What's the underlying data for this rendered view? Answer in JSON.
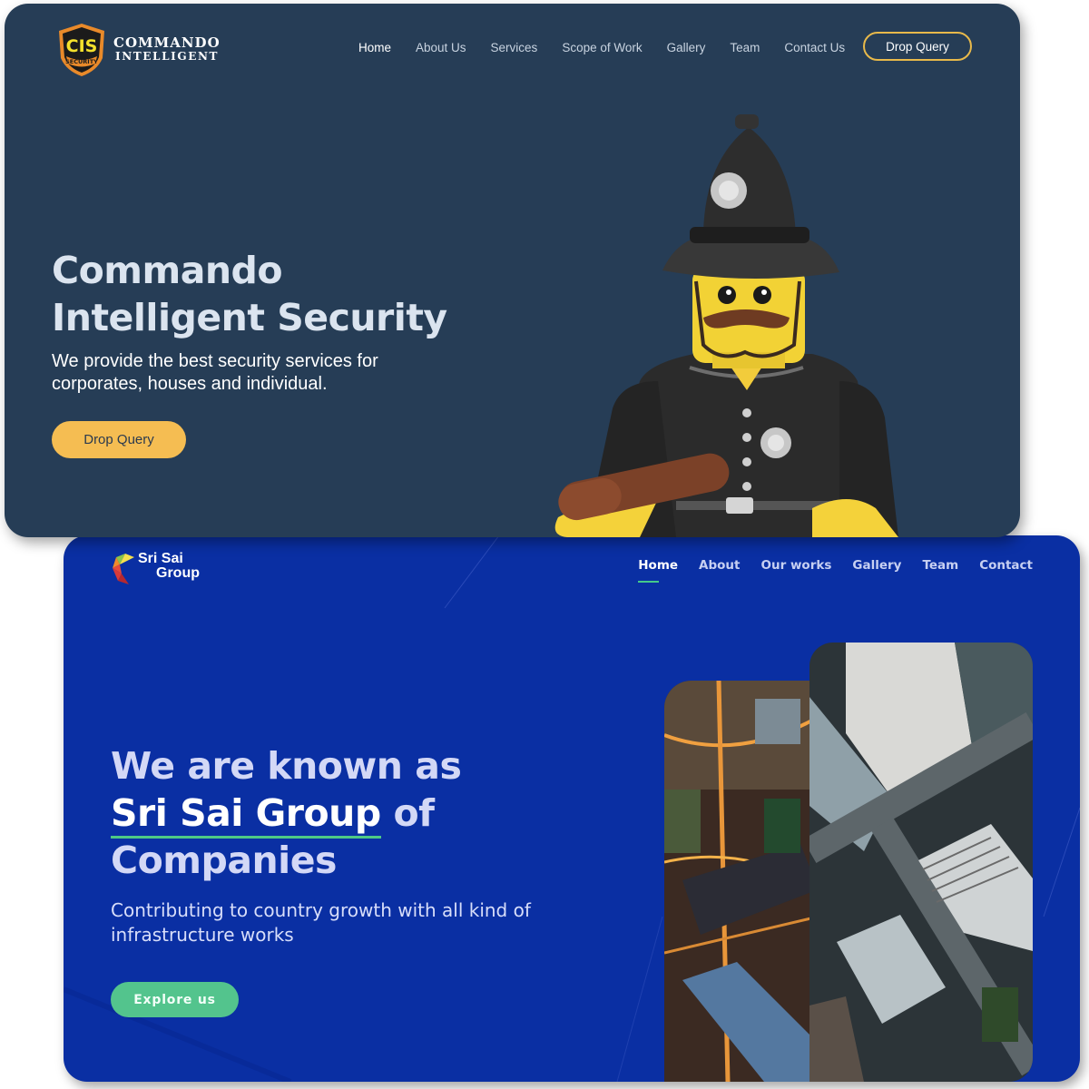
{
  "commando": {
    "logo": {
      "badge_text": "CIS",
      "badge_subtext": "SECURITY",
      "line1": "COMMANDO",
      "line2": "INTELLIGENT"
    },
    "nav": [
      {
        "label": "Home",
        "active": true
      },
      {
        "label": "About Us",
        "active": false
      },
      {
        "label": "Services",
        "active": false
      },
      {
        "label": "Scope of Work",
        "active": false
      },
      {
        "label": "Gallery",
        "active": false
      },
      {
        "label": "Team",
        "active": false
      },
      {
        "label": "Contact Us",
        "active": false
      }
    ],
    "nav_button": "Drop Query",
    "hero": {
      "title_line1": "Commando",
      "title_line2": "Intelligent Security",
      "subtitle_line1": "We provide the best security services for",
      "subtitle_line2": "corporates, houses and individual.",
      "cta": "Drop Query"
    },
    "hero_image": "lego-police-officer-figure",
    "colors": {
      "background": "#263d56",
      "accent": "#f5bd52",
      "outline": "#e8b94a"
    }
  },
  "srisai": {
    "logo": {
      "line1": "Sri Sai",
      "line2": "Group"
    },
    "nav": [
      {
        "label": "Home",
        "active": true
      },
      {
        "label": "About",
        "active": false
      },
      {
        "label": "Our works",
        "active": false
      },
      {
        "label": "Gallery",
        "active": false
      },
      {
        "label": "Team",
        "active": false
      },
      {
        "label": "Contact",
        "active": false
      }
    ],
    "hero": {
      "title_line1": "We are known as",
      "title_highlight": "Sri Sai Group",
      "title_line2_rest": " of",
      "title_line3": "Companies",
      "subtitle_line1": "Contributing to country growth with all kind of",
      "subtitle_line2": "infrastructure works",
      "cta": "Explore us"
    },
    "images": [
      "aerial-city-night",
      "aerial-city-intersection"
    ],
    "colors": {
      "background": "#0a2fa3",
      "accent": "#53c48d"
    }
  }
}
